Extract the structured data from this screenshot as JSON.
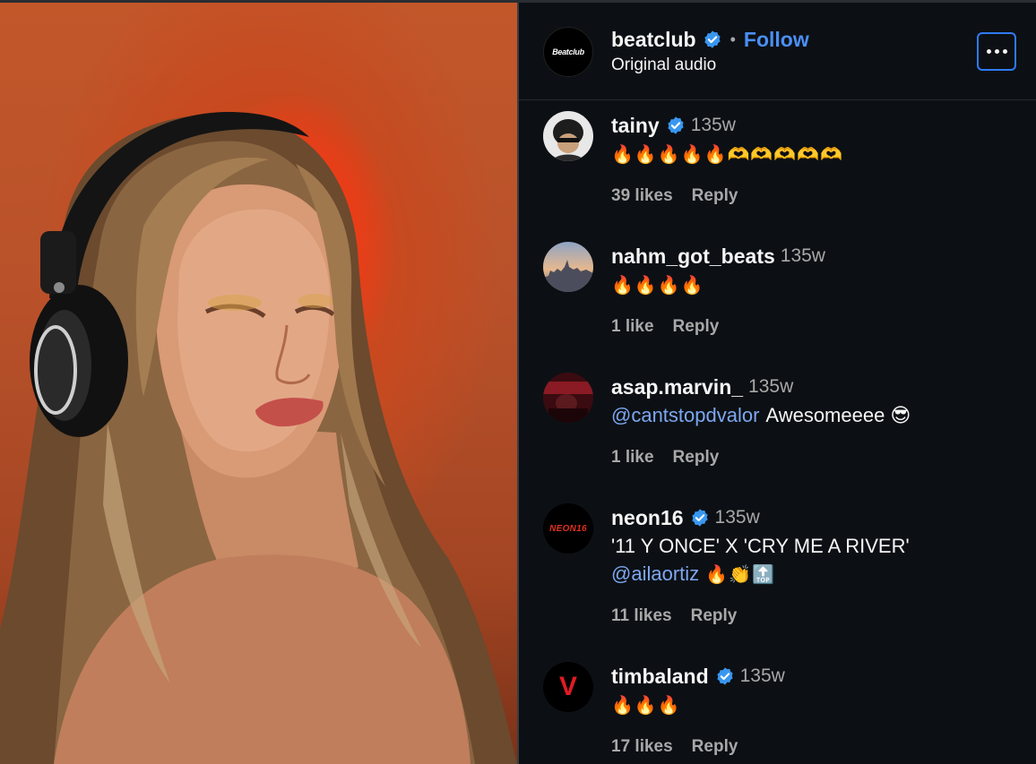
{
  "post": {
    "account": "beatclub",
    "avatar_text": "Beatclub",
    "verified": true,
    "follow_label": "Follow",
    "subtitle": "Original audio",
    "more_icon": "more-horizontal-icon"
  },
  "comments": [
    {
      "user": "tainy",
      "verified": true,
      "time": "135w",
      "text": "🔥🔥🔥🔥🔥🫶🫶🫶🫶🫶",
      "likes": "39 likes",
      "reply": "Reply"
    },
    {
      "user": "nahm_got_beats",
      "verified": false,
      "time": "135w",
      "text": "🔥🔥🔥🔥",
      "likes": "1 like",
      "reply": "Reply"
    },
    {
      "user": "asap.marvin_",
      "verified": false,
      "time": "135w",
      "mention": "@cantstopdvalor",
      "text": "Awesomeeee 😎",
      "likes": "1 like",
      "reply": "Reply"
    },
    {
      "user": "neon16",
      "verified": true,
      "time": "135w",
      "text": "'11 Y ONCE' X 'CRY ME A RIVER'",
      "mention": "@ailaortiz",
      "text2": "🔥👏🔝",
      "avatar_text": "NEON16",
      "likes": "11 likes",
      "reply": "Reply"
    },
    {
      "user": "timbaland",
      "verified": true,
      "time": "135w",
      "text": "🔥🔥🔥",
      "avatar_text": "V",
      "likes": "17 likes",
      "reply": "Reply"
    }
  ],
  "colors": {
    "background": "#0c1014",
    "accent": "#4a8ff5",
    "verified": "#3897f0",
    "mention": "#7da7f0",
    "muted": "#a8a8a8"
  }
}
